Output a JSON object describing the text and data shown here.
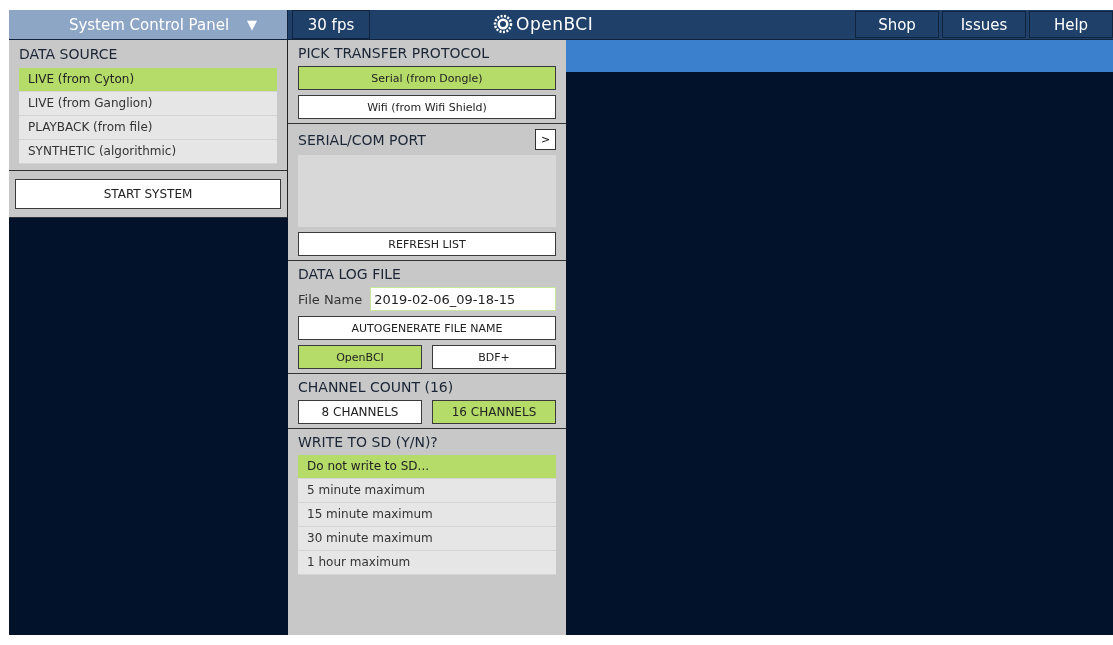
{
  "top_bar": {
    "panel_menu": {
      "label": "System Control Panel",
      "caret": "▼",
      "expanded": true
    },
    "fps": "30 fps",
    "logo": "OpenBCI",
    "links": [
      "Shop",
      "Issues",
      "Help"
    ]
  },
  "data_source": {
    "title": "DATA SOURCE",
    "items": [
      {
        "label": "LIVE (from Cyton)",
        "selected": true
      },
      {
        "label": "LIVE (from Ganglion)",
        "selected": false
      },
      {
        "label": "PLAYBACK (from file)",
        "selected": false
      },
      {
        "label": "SYNTHETIC (algorithmic)",
        "selected": false
      }
    ],
    "start_button": "START SYSTEM"
  },
  "transfer_protocol": {
    "title": "PICK TRANSFER PROTOCOL",
    "options": [
      {
        "label": "Serial (from Dongle)",
        "selected": true
      },
      {
        "label": "Wifi (from Wifi Shield)",
        "selected": false
      }
    ]
  },
  "serial_port": {
    "title": "SERIAL/COM PORT",
    "expand_button": ">",
    "refresh_button": "REFRESH LIST"
  },
  "data_log": {
    "title": "DATA LOG FILE",
    "file_name_label": "File Name",
    "file_name": "2019-02-06_09-18-15",
    "autogenerate_button": "AUTOGENERATE FILE NAME",
    "formats": [
      {
        "label": "OpenBCI",
        "selected": true
      },
      {
        "label": "BDF+",
        "selected": false
      }
    ]
  },
  "channel_count": {
    "title": "CHANNEL COUNT (16)",
    "options": [
      {
        "label": "8 CHANNELS",
        "selected": false
      },
      {
        "label": "16 CHANNELS",
        "selected": true
      }
    ]
  },
  "write_sd": {
    "title": "WRITE TO SD (Y/N)?",
    "items": [
      {
        "label": "Do not write to SD...",
        "selected": true
      },
      {
        "label": "5 minute maximum",
        "selected": false
      },
      {
        "label": "15 minute maximum",
        "selected": false
      },
      {
        "label": "30 minute maximum",
        "selected": false
      },
      {
        "label": "1 hour maximum",
        "selected": false
      }
    ]
  }
}
